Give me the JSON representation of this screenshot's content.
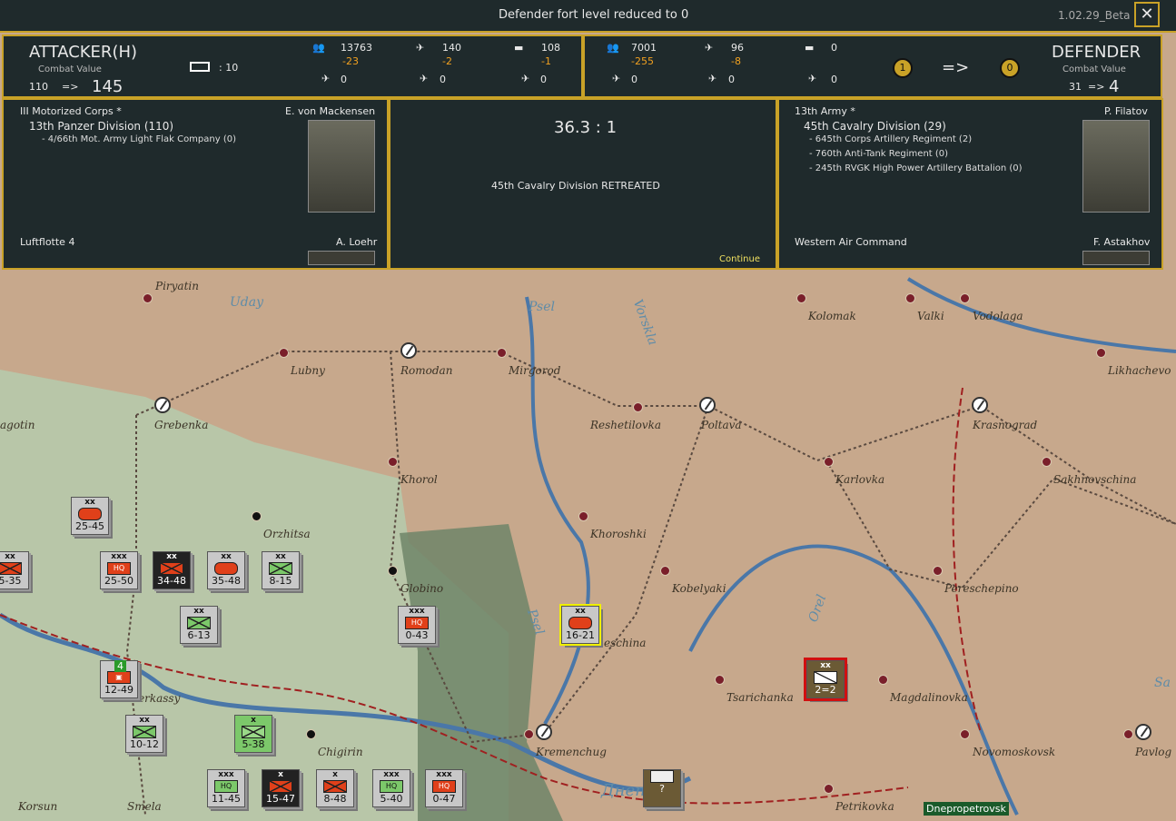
{
  "topbar": {
    "message": "Defender fort level reduced to 0",
    "version": "1.02.29_Beta",
    "close_label": "✕"
  },
  "attacker": {
    "title": "ATTACKER(H)",
    "cv_label": "Combat Value",
    "cv_base": "110",
    "arrow": "=>",
    "cv_final": "145",
    "fort_value": ": 10",
    "men": "13763",
    "men_loss": "-23",
    "afv_air": "140",
    "afv_air_loss": "-2",
    "tanks": "108",
    "tanks_loss": "-1",
    "air1": "0",
    "air2": "0",
    "air3": "0"
  },
  "defender": {
    "title": "DEFENDER",
    "cv_label": "Combat Value",
    "cv_base": "31",
    "arrow": "=>",
    "cv_final": "4",
    "men": "7001",
    "men_loss": "-255",
    "afv_air": "96",
    "afv_air_loss": "-8",
    "tanks": "0",
    "air1": "0",
    "air2": "0",
    "air3": "0",
    "fort_before": "1",
    "fort_arrow": "=>",
    "fort_after": "0"
  },
  "attacker_detail": {
    "corps": "III Motorized Corps *",
    "commander": "E. von Mackensen",
    "division": "13th Panzer Division (110)",
    "attachments": [
      "- 4/66th Mot. Army Light Flak Company (0)"
    ],
    "air_command": "Luftflotte 4",
    "air_commander": "A. Loehr"
  },
  "result": {
    "odds": "36.3 : 1",
    "outcome": "45th Cavalry Division RETREATED",
    "continue_label": "Continue"
  },
  "defender_detail": {
    "army": "13th Army *",
    "commander": "P. Filatov",
    "division": "45th Cavalry Division (29)",
    "attachments": [
      "- 645th Corps Artillery Regiment (2)",
      "- 760th Anti-Tank Regiment (0)",
      "- 245th RVGK High Power Artillery Battalion (0)"
    ],
    "air_command": "Western Air Command",
    "air_commander": "F. Astakhov"
  },
  "map": {
    "cities": [
      "Piryatin",
      "Lubny",
      "Romodan",
      "Mirgorod",
      "Kolomak",
      "Valki",
      "Vodolaga",
      "Likhachevo",
      "agotin",
      "Grebenka",
      "Reshetilovka",
      "Poltava",
      "Krasnograd",
      "Khorol",
      "Karlovka",
      "Sakhnovschina",
      "Orzhitsa",
      "Khoroshki",
      "Globino",
      "Kobelyaki",
      "Pereschepino",
      "eschina",
      "erkassy",
      "Tsarichanka",
      "Magdalinovka",
      "Chigirin",
      "Kremenchug",
      "Novomoskovsk",
      "Pavlog",
      "Korsun",
      "Smela",
      "Petrikovka"
    ],
    "rivers": [
      "Uday",
      "Psel",
      "Vorskla",
      "Psel",
      "Orel",
      "Днеп",
      "Sa"
    ],
    "highlight_label": "Dnepropetrovsk"
  },
  "units": [
    {
      "size": "xx",
      "str": "25-45"
    },
    {
      "size": "xx",
      "str": "5-35"
    },
    {
      "size": "xxx",
      "str": "25-50"
    },
    {
      "size": "xx",
      "str": "34-48"
    },
    {
      "size": "xx",
      "str": "35-48"
    },
    {
      "size": "xx",
      "str": "8-15"
    },
    {
      "size": "xx",
      "str": "6-13"
    },
    {
      "size": "xxx",
      "str": "0-43"
    },
    {
      "size": "xx",
      "str": "16-21"
    },
    {
      "size": "xx",
      "str": "2=2"
    },
    {
      "size": "x",
      "str": "12-49"
    },
    {
      "size": "xx",
      "str": "10-12"
    },
    {
      "size": "x",
      "str": "5-38"
    },
    {
      "size": "xxx",
      "str": "11-45"
    },
    {
      "size": "x",
      "str": "15-47"
    },
    {
      "size": "x",
      "str": "8-48"
    },
    {
      "size": "xxx",
      "str": "5-40"
    },
    {
      "size": "xxx",
      "str": "0-47"
    },
    {
      "size": "",
      "str": "?"
    }
  ],
  "stack_badge": "4"
}
